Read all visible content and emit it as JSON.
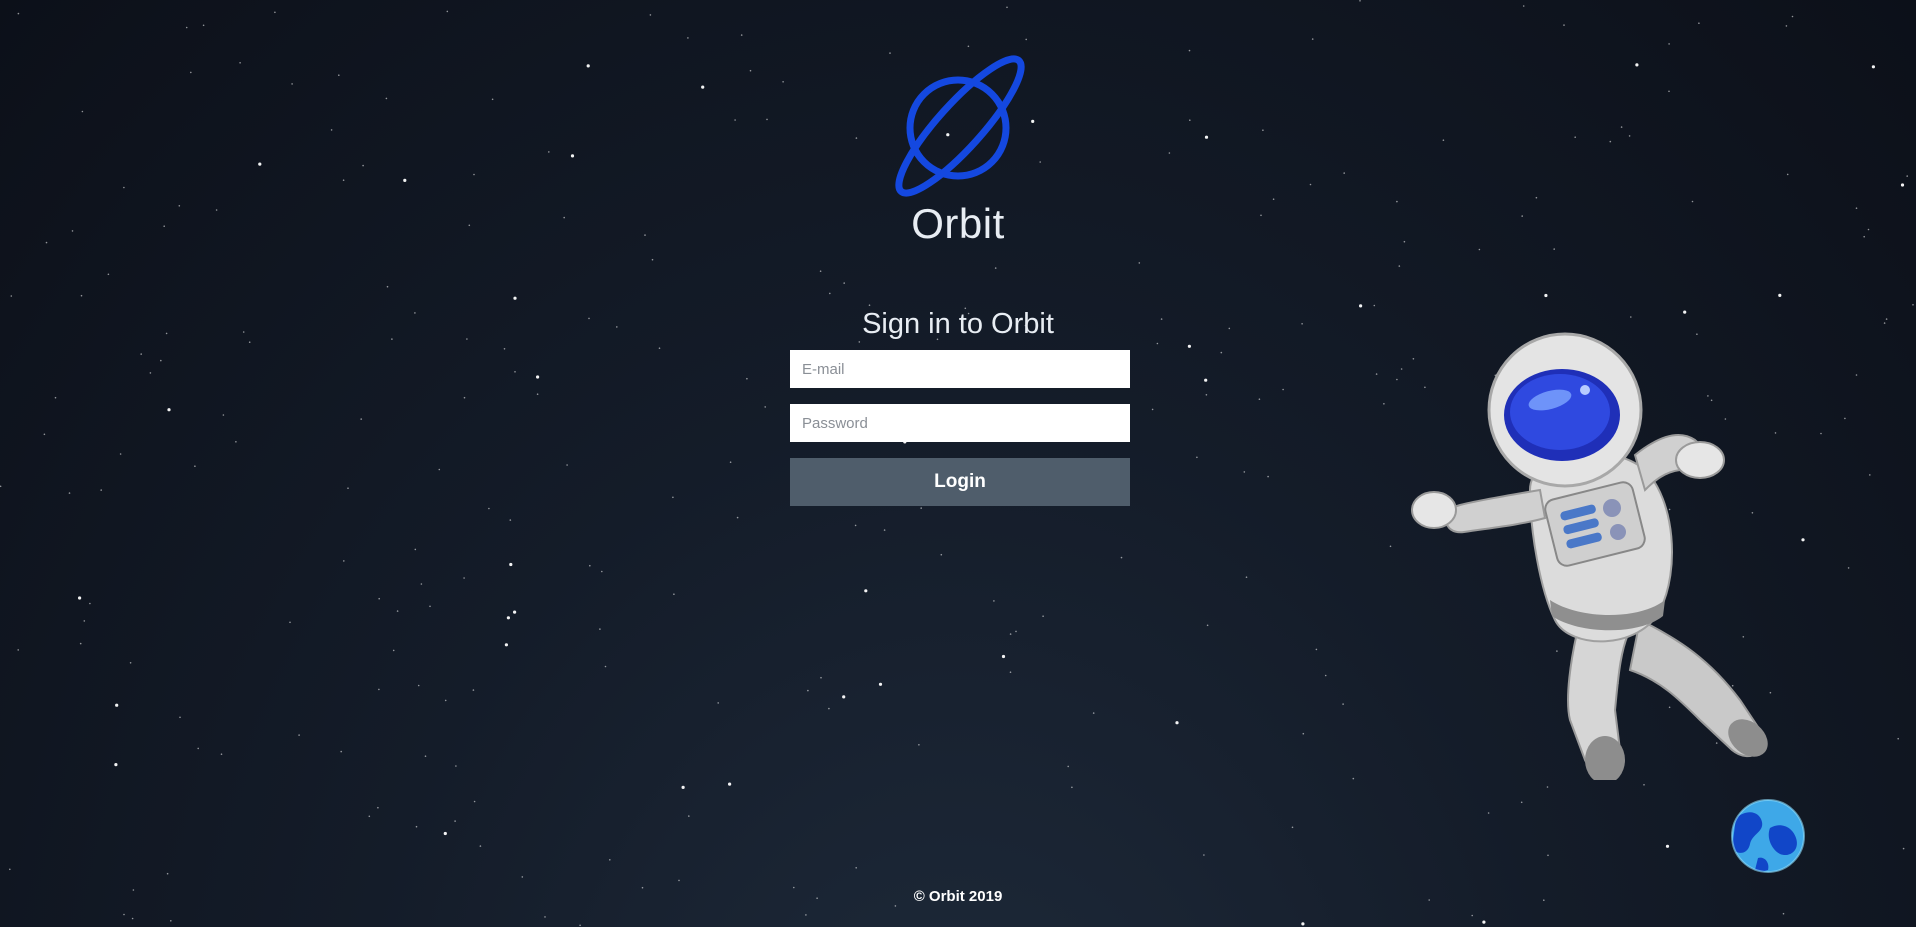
{
  "app": {
    "brand_name": "Orbit",
    "logo_icon": "planet-ring-icon",
    "accent_color": "#1448e0"
  },
  "login": {
    "title": "Sign in to Orbit",
    "email_placeholder": "E-mail",
    "email_value": "",
    "password_placeholder": "Password",
    "password_value": "",
    "submit_label": "Login",
    "button_color": "#4f5d6b"
  },
  "footer": {
    "copyright": "© Orbit 2019"
  },
  "illustrations": {
    "astronaut": "astronaut-illustration",
    "earth": "earth-globe-icon"
  }
}
